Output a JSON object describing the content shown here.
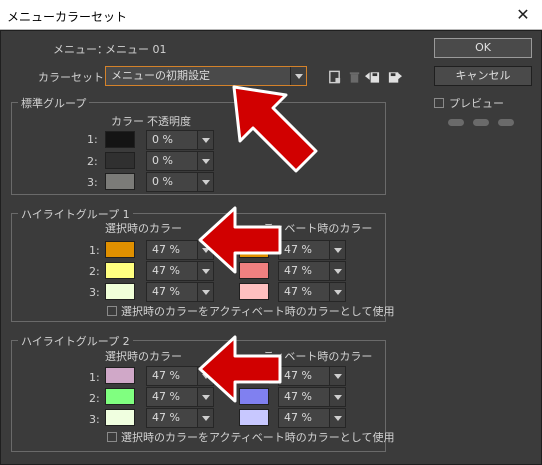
{
  "window": {
    "title": "メニューカラーセット",
    "close_glyph": "✕"
  },
  "menu": {
    "label": "メニュー：",
    "value": "メニュー 01"
  },
  "colorset": {
    "label": "カラーセット：",
    "value": "メニューの初期設定"
  },
  "buttons": {
    "ok": "OK",
    "cancel": "キャンセル"
  },
  "preview": {
    "label": "プレビュー"
  },
  "standard_group": {
    "title": "標準グループ",
    "col_color": "カラー",
    "col_opacity": "不透明度",
    "rows": [
      {
        "num": "1:",
        "color": "#141414",
        "opacity": "0 %"
      },
      {
        "num": "2:",
        "color": "#303030",
        "opacity": "0 %"
      },
      {
        "num": "3:",
        "color": "#7b7b78",
        "opacity": "0 %"
      }
    ]
  },
  "highlight1": {
    "title": "ハイライトグループ 1",
    "col_selected": "選択時のカラー",
    "col_active": "アクティベート時のカラー",
    "col_active_visible": "ティベート時のカラー",
    "rows": [
      {
        "num": "1:",
        "sel_color": "#e09000",
        "sel_opacity": "47 %",
        "act_color": "#e09000",
        "act_opacity": "47 %"
      },
      {
        "num": "2:",
        "sel_color": "#ffff80",
        "sel_opacity": "47 %",
        "act_color": "#f08080",
        "act_opacity": "47 %"
      },
      {
        "num": "3:",
        "sel_color": "#f0ffd8",
        "sel_opacity": "47 %",
        "act_color": "#ffc0c0",
        "act_opacity": "47 %"
      }
    ],
    "checkbox_label": "選択時のカラーをアクティベート時のカラーとして使用"
  },
  "highlight2": {
    "title": "ハイライトグループ 2",
    "col_selected": "選択時のカラー",
    "col_active": "アクティベート時のカラー",
    "col_active_visible": "ティベート時のカラー",
    "rows": [
      {
        "num": "1:",
        "sel_color": "#d0a8c8",
        "sel_opacity": "47 %",
        "act_color": "#d0a8c8",
        "act_opacity": "47 %"
      },
      {
        "num": "2:",
        "sel_color": "#80ff80",
        "sel_opacity": "47 %",
        "act_color": "#8080f0",
        "act_opacity": "47 %"
      },
      {
        "num": "3:",
        "sel_color": "#f0ffe0",
        "sel_opacity": "47 %",
        "act_color": "#c8c8ff",
        "act_opacity": "47 %"
      }
    ],
    "checkbox_label": "選択時のカラーをアクティベート時のカラーとして使用"
  },
  "icons": [
    "new-icon",
    "trash-icon",
    "import-icon",
    "save-icon"
  ],
  "annotation_color": "#d10000"
}
